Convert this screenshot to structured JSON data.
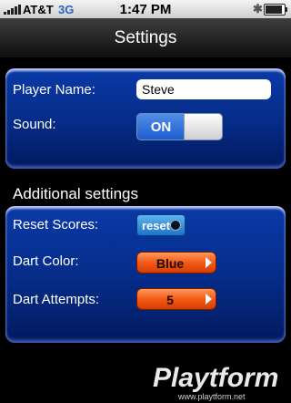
{
  "status_bar": {
    "carrier": "AT&T",
    "network": "3G",
    "time": "1:47 PM",
    "battery_level": 0.9
  },
  "nav": {
    "title": "Settings"
  },
  "player": {
    "name_label": "Player Name:",
    "name_value": "Steve",
    "sound_label": "Sound:",
    "sound_toggle_label": "ON"
  },
  "additional": {
    "title": "Additional settings",
    "reset_scores_label": "Reset Scores:",
    "reset_button_label": "reset",
    "dart_color_label": "Dart Color:",
    "dart_color_value": "Blue",
    "dart_attempts_label": "Dart Attempts:",
    "dart_attempts_value": "5"
  },
  "watermark": {
    "brand": "Playtform",
    "url": "www.playtform.net"
  },
  "colors": {
    "panel_blue": "#0a3aa8",
    "toggle_blue": "#1d5ed0",
    "select_orange": "#f35a16"
  }
}
